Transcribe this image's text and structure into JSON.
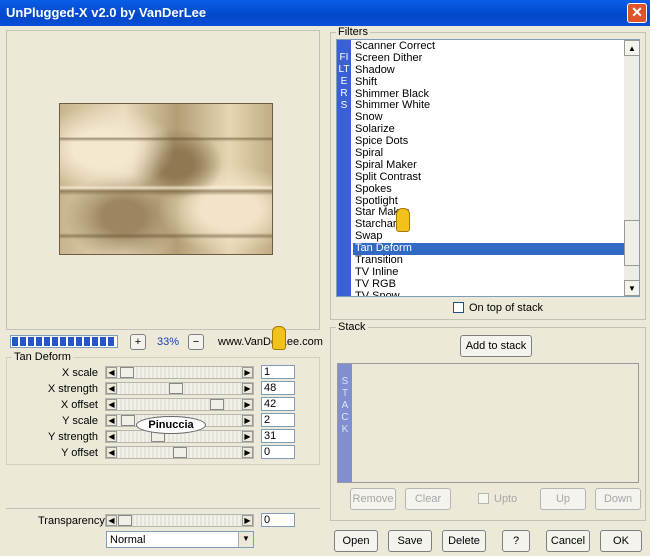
{
  "window": {
    "title": "UnPlugged-X v2.0 by VanDerLee",
    "close": "✕"
  },
  "preview": {
    "zoom_minus": "−",
    "zoom_plus": "+",
    "zoom": "33%",
    "url": "www.VanDerLee.com"
  },
  "params": {
    "group_title": "Tan Deform",
    "rows": [
      {
        "label": "X scale",
        "value": "1",
        "pos": 0.02
      },
      {
        "label": "X strength",
        "value": "48",
        "pos": 0.47
      },
      {
        "label": "X offset",
        "value": "42",
        "pos": 0.84
      },
      {
        "label": "Y scale",
        "value": "2",
        "pos": 0.03
      },
      {
        "label": "Y strength",
        "value": "31",
        "pos": 0.3
      },
      {
        "label": "Y offset",
        "value": "0",
        "pos": 0.5
      }
    ],
    "transparency_label": "Transparency",
    "transparency_value": "0",
    "transparency_pos": 0.0,
    "blend_mode": "Normal",
    "watermark": "Pinuccia"
  },
  "filters": {
    "legend": "Filters",
    "side_label": "FILTERS",
    "items": [
      "Scanner Correct",
      "Screen Dither",
      "Shadow",
      "Shift",
      "Shimmer Black",
      "Shimmer White",
      "Snow",
      "Solarize",
      "Spice Dots",
      "Spiral",
      "Spiral Maker",
      "Split Contrast",
      "Spokes",
      "Spotlight",
      "Star Maker",
      "Starchart",
      "Swap",
      "Tan Deform",
      "Transition",
      "TV Inline",
      "TV RGB",
      "TV Snow"
    ],
    "selected": "Tan Deform",
    "on_top_label": "On top of stack"
  },
  "stack": {
    "legend": "Stack",
    "side_label": "STACK",
    "add_label": "Add to stack",
    "remove_label": "Remove",
    "clear_label": "Clear",
    "upto_label": "Upto",
    "up_label": "Up",
    "down_label": "Down"
  },
  "footer": {
    "open": "Open",
    "save": "Save",
    "delete": "Delete",
    "help": "?",
    "cancel": "Cancel",
    "ok": "OK"
  },
  "colors": {
    "title_bar": "#0a5ee8",
    "selection": "#316ac5",
    "side_bar": "#3b5fd8",
    "progress": "#2456c8"
  }
}
